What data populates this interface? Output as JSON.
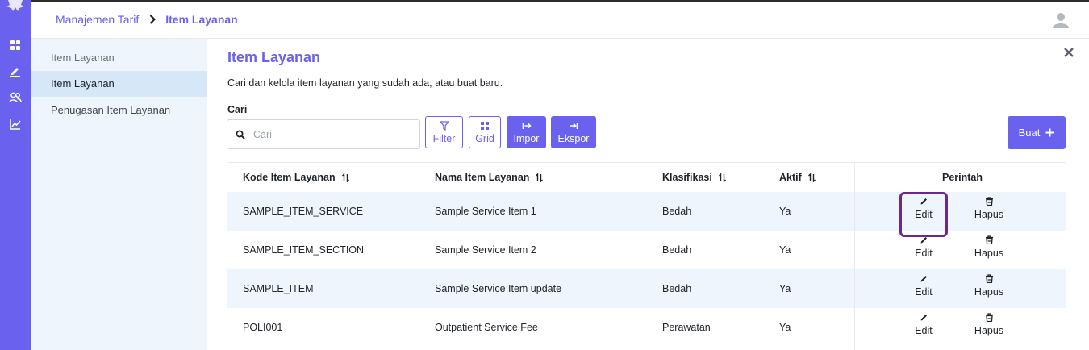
{
  "breadcrumb": {
    "parent": "Manajemen Tarif",
    "current": "Item Layanan"
  },
  "sidebar": {
    "items": [
      {
        "label": "Item Layanan",
        "state": "muted"
      },
      {
        "label": "Item Layanan",
        "state": "active"
      },
      {
        "label": "Penugasan Item Layanan",
        "state": "normal"
      }
    ]
  },
  "page": {
    "title": "Item Layanan",
    "subtitle": "Cari dan kelola item layanan yang sudah ada, atau buat baru.",
    "search_label": "Cari",
    "search_placeholder": "Cari",
    "search_value": ""
  },
  "toolbar": {
    "filter": "Filter",
    "grid": "Grid",
    "import": "Impor",
    "export": "Ekspor",
    "create": "Buat"
  },
  "table": {
    "headers": {
      "code": "Kode Item Layanan",
      "name": "Nama Item Layanan",
      "classification": "Klasifikasi",
      "active": "Aktif",
      "actions": "Perintah"
    },
    "action_labels": {
      "edit": "Edit",
      "delete": "Hapus"
    },
    "rows": [
      {
        "code": "SAMPLE_ITEM_SERVICE",
        "name": "Sample Service Item 1",
        "classification": "Bedah",
        "active": "Ya"
      },
      {
        "code": "SAMPLE_ITEM_SECTION",
        "name": "Sample Service Item 2",
        "classification": "Bedah",
        "active": "Ya"
      },
      {
        "code": "SAMPLE_ITEM",
        "name": "Sample Service Item update",
        "classification": "Bedah",
        "active": "Ya"
      },
      {
        "code": "POLI001",
        "name": "Outpatient Service Fee",
        "classification": "Perawatan",
        "active": "Ya"
      }
    ]
  },
  "colors": {
    "accent": "#6a62ee",
    "row_alt": "#eef5fc",
    "sidebar_active": "#d6e7f8",
    "highlight": "#6a2a8c"
  },
  "icons": [
    "app-logo-icon",
    "dashboard-icon",
    "edit-nav-icon",
    "users-icon",
    "chart-icon",
    "chevron-right-icon",
    "user-avatar-icon",
    "close-icon",
    "search-icon",
    "filter-icon",
    "grid-icon",
    "import-icon",
    "export-icon",
    "plus-icon",
    "sort-icon",
    "pencil-icon",
    "trash-icon"
  ]
}
